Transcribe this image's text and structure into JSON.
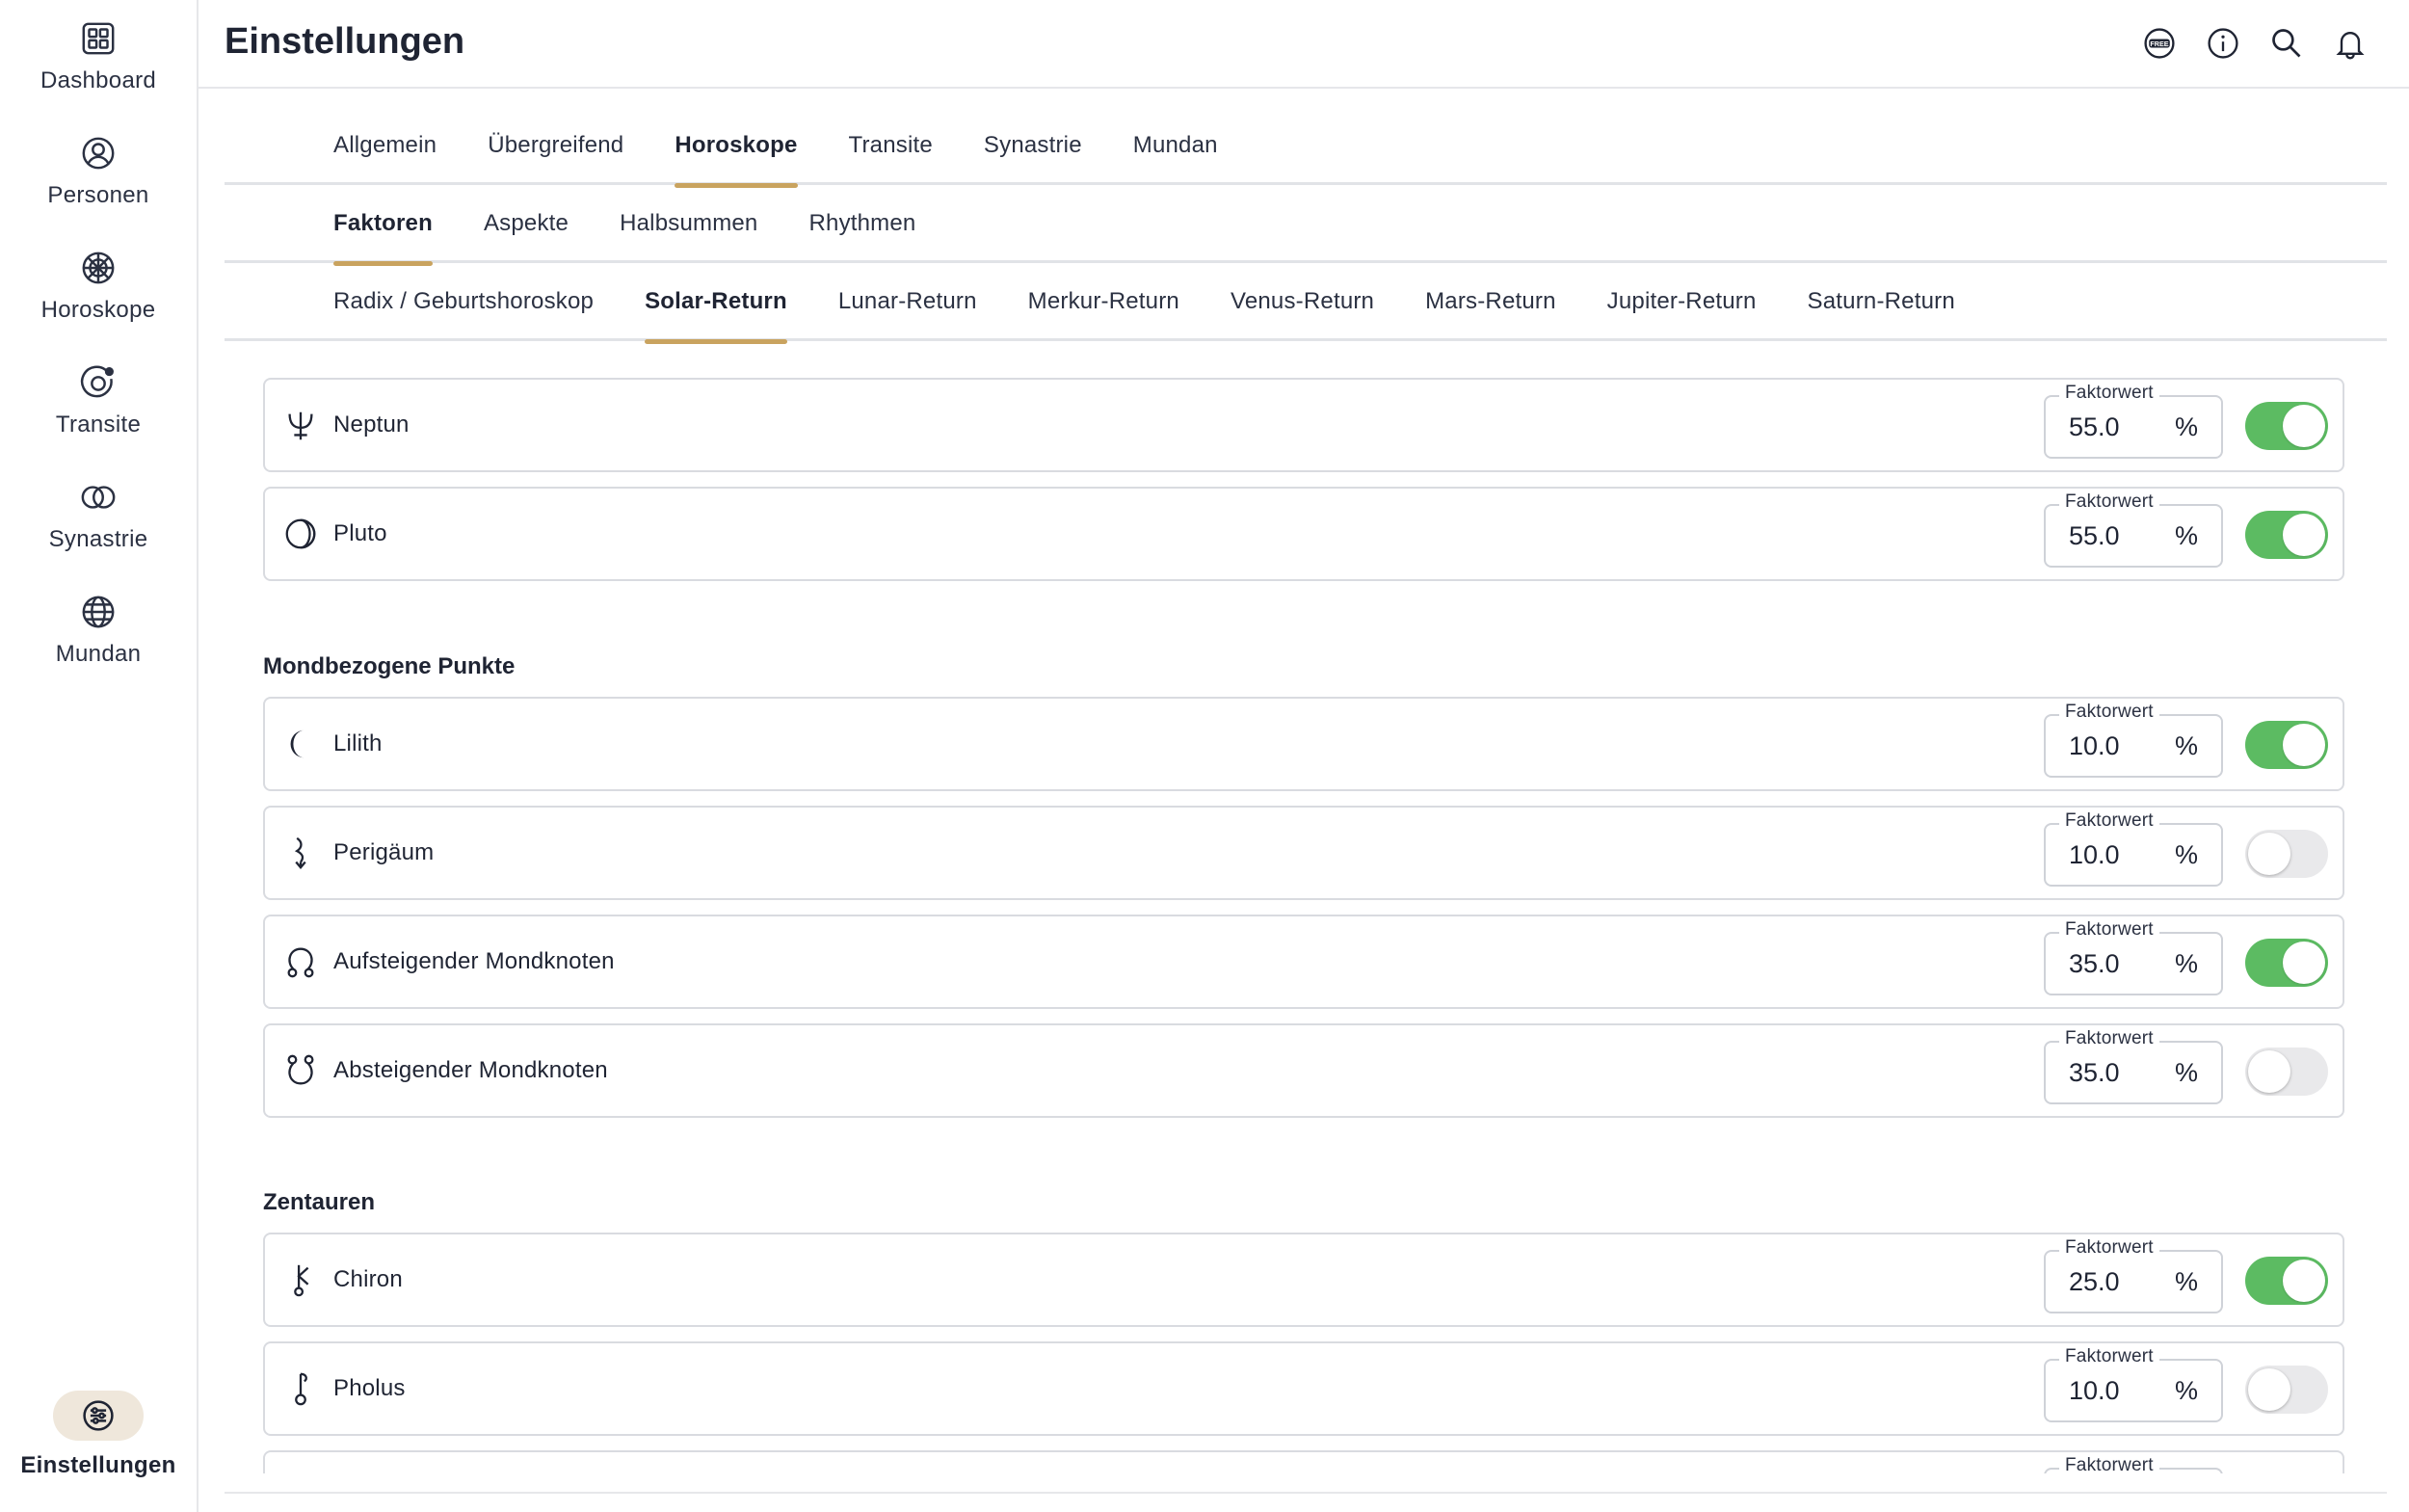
{
  "sidebar": {
    "items": [
      {
        "label": "Dashboard",
        "icon": "dashboard-icon"
      },
      {
        "label": "Personen",
        "icon": "person-icon"
      },
      {
        "label": "Horoskope",
        "icon": "horoscope-wheel-icon"
      },
      {
        "label": "Transite",
        "icon": "transit-icon"
      },
      {
        "label": "Synastrie",
        "icon": "synastry-icon"
      },
      {
        "label": "Mundan",
        "icon": "globe-icon"
      }
    ],
    "settings": {
      "label": "Einstellungen",
      "icon": "sliders-icon"
    }
  },
  "header": {
    "title": "Einstellungen",
    "icons": [
      "free-badge-icon",
      "info-icon",
      "search-icon",
      "bell-icon"
    ],
    "free_badge_text": "FREE"
  },
  "tabs_primary": {
    "items": [
      "Allgemein",
      "Übergreifend",
      "Horoskope",
      "Transite",
      "Synastrie",
      "Mundan"
    ],
    "active": "Horoskope"
  },
  "tabs_secondary": {
    "items": [
      "Faktoren",
      "Aspekte",
      "Halbsummen",
      "Rhythmen"
    ],
    "active": "Faktoren"
  },
  "tabs_tertiary": {
    "items": [
      "Radix / Geburtshoroskop",
      "Solar-Return",
      "Lunar-Return",
      "Merkur-Return",
      "Venus-Return",
      "Mars-Return",
      "Jupiter-Return",
      "Saturn-Return"
    ],
    "active": "Solar-Return"
  },
  "field_legend": "Faktorwert",
  "unit": "%",
  "planets_rows": [
    {
      "name": "Neptun",
      "icon": "neptune-glyph-icon",
      "value": "55.0",
      "enabled": true
    },
    {
      "name": "Pluto",
      "icon": "pluto-glyph-icon",
      "value": "55.0",
      "enabled": true
    }
  ],
  "moon_points": {
    "heading": "Mondbezogene Punkte",
    "rows": [
      {
        "name": "Lilith",
        "icon": "lilith-crescent-icon",
        "value": "10.0",
        "enabled": true
      },
      {
        "name": "Perigäum",
        "icon": "perigee-glyph-icon",
        "value": "10.0",
        "enabled": false
      },
      {
        "name": "Aufsteigender Mondknoten",
        "icon": "north-node-icon",
        "value": "35.0",
        "enabled": true
      },
      {
        "name": "Absteigender Mondknoten",
        "icon": "south-node-icon",
        "value": "35.0",
        "enabled": false
      }
    ]
  },
  "centaurs": {
    "heading": "Zentauren",
    "rows": [
      {
        "name": "Chiron",
        "icon": "chiron-glyph-icon",
        "value": "25.0",
        "enabled": true
      },
      {
        "name": "Pholus",
        "icon": "pholus-glyph-icon",
        "value": "10.0",
        "enabled": false
      }
    ]
  },
  "colors": {
    "accent_gold": "#c9a35f",
    "toggle_on": "#5cbb62",
    "toggle_off": "#e9e9eb",
    "settings_pill": "#efe7db"
  }
}
